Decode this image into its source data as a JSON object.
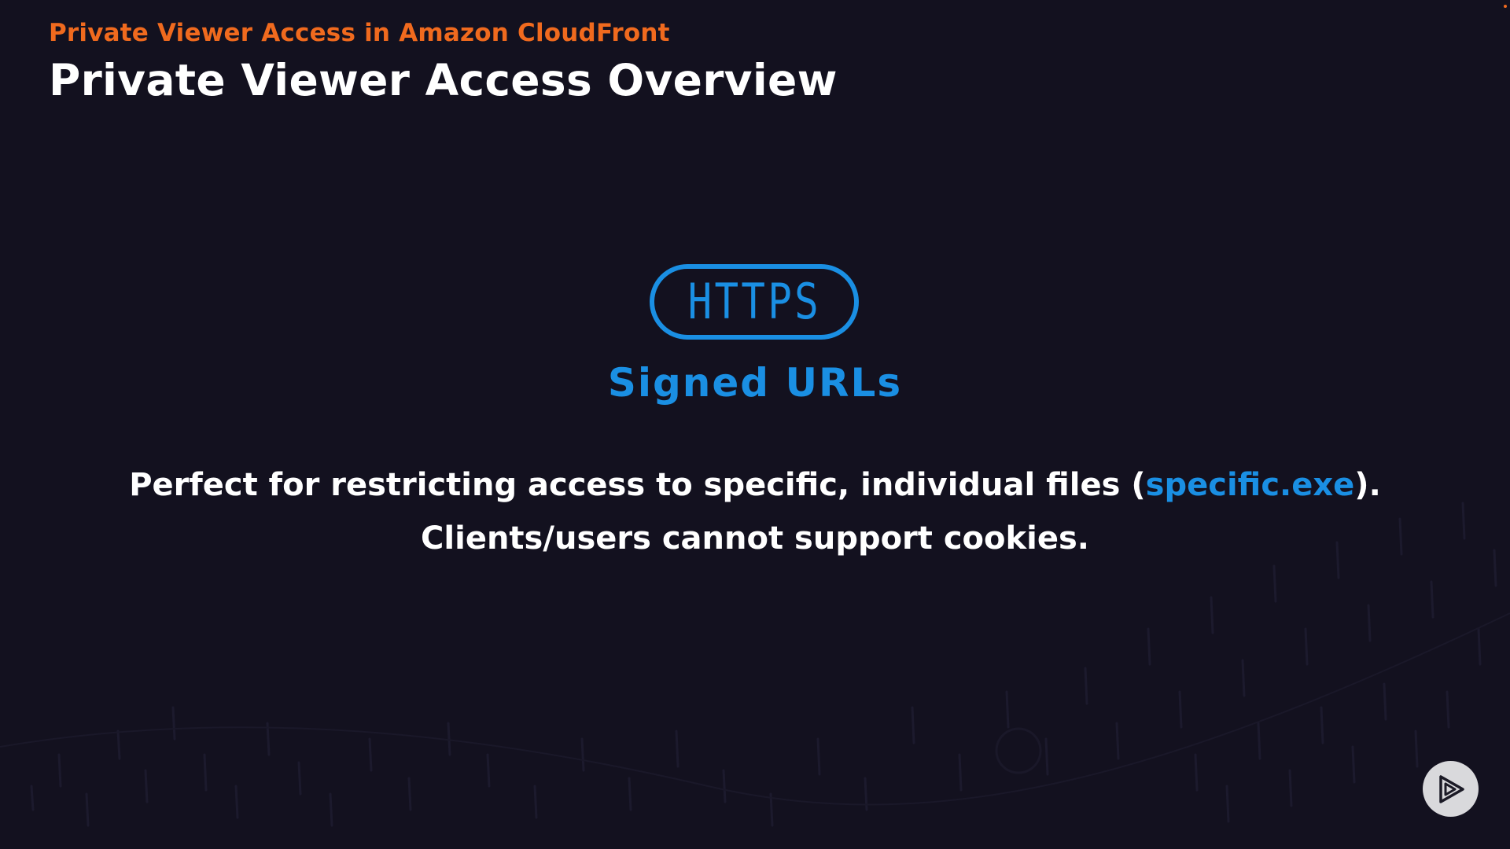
{
  "header": {
    "course_title": "Private Viewer Access in Amazon CloudFront",
    "slide_title": "Private Viewer Access Overview"
  },
  "feature": {
    "badge_text": "HTTPS",
    "label": "Signed URLs"
  },
  "description": {
    "line1_before": "Perfect for restricting access to specific, individual files (",
    "line1_highlight": "specific.exe",
    "line1_after": ").",
    "line2": "Clients/users cannot support cookies."
  },
  "controls": {
    "play_icon": "play-logo-icon"
  },
  "colors": {
    "background": "#13111f",
    "accent_orange": "#f06a1e",
    "accent_blue": "#1a8fe3",
    "text": "#ffffff"
  }
}
